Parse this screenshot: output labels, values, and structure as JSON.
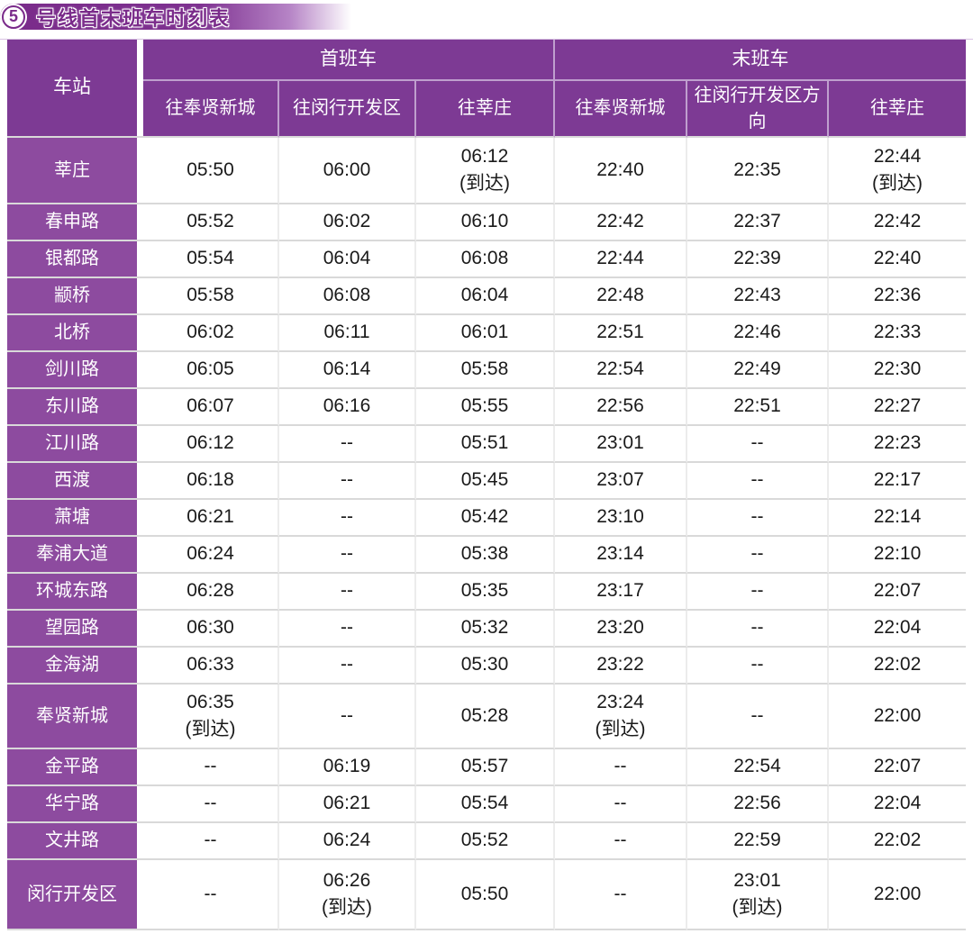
{
  "title": {
    "line_number": "5",
    "text": "号线首末班车时刻表"
  },
  "table": {
    "station_header": "车站",
    "groups": [
      {
        "label": "首班车",
        "columns": [
          "往奉贤新城",
          "往闵行开发区",
          "往莘庄"
        ]
      },
      {
        "label": "末班车",
        "columns": [
          "往奉贤新城",
          "往闵行开发区方向",
          "往莘庄"
        ]
      }
    ],
    "rows": [
      {
        "station": "莘庄",
        "times": [
          "05:50",
          "06:00",
          "06:12\n(到达)",
          "22:40",
          "22:35",
          "22:44\n(到达)"
        ]
      },
      {
        "station": "春申路",
        "times": [
          "05:52",
          "06:02",
          "06:10",
          "22:42",
          "22:37",
          "22:42"
        ]
      },
      {
        "station": "银都路",
        "times": [
          "05:54",
          "06:04",
          "06:08",
          "22:44",
          "22:39",
          "22:40"
        ]
      },
      {
        "station": "颛桥",
        "times": [
          "05:58",
          "06:08",
          "06:04",
          "22:48",
          "22:43",
          "22:36"
        ]
      },
      {
        "station": "北桥",
        "times": [
          "06:02",
          "06:11",
          "06:01",
          "22:51",
          "22:46",
          "22:33"
        ]
      },
      {
        "station": "剑川路",
        "times": [
          "06:05",
          "06:14",
          "05:58",
          "22:54",
          "22:49",
          "22:30"
        ]
      },
      {
        "station": "东川路",
        "times": [
          "06:07",
          "06:16",
          "05:55",
          "22:56",
          "22:51",
          "22:27"
        ]
      },
      {
        "station": "江川路",
        "times": [
          "06:12",
          "--",
          "05:51",
          "23:01",
          "--",
          "22:23"
        ]
      },
      {
        "station": "西渡",
        "times": [
          "06:18",
          "--",
          "05:45",
          "23:07",
          "--",
          "22:17"
        ]
      },
      {
        "station": "萧塘",
        "times": [
          "06:21",
          "--",
          "05:42",
          "23:10",
          "--",
          "22:14"
        ]
      },
      {
        "station": "奉浦大道",
        "times": [
          "06:24",
          "--",
          "05:38",
          "23:14",
          "--",
          "22:10"
        ]
      },
      {
        "station": "环城东路",
        "times": [
          "06:28",
          "--",
          "05:35",
          "23:17",
          "--",
          "22:07"
        ]
      },
      {
        "station": "望园路",
        "times": [
          "06:30",
          "--",
          "05:32",
          "23:20",
          "--",
          "22:04"
        ]
      },
      {
        "station": "金海湖",
        "times": [
          "06:33",
          "--",
          "05:30",
          "23:22",
          "--",
          "22:02"
        ]
      },
      {
        "station": "奉贤新城",
        "times": [
          "06:35\n(到达)",
          "--",
          "05:28",
          "23:24\n(到达)",
          "--",
          "22:00"
        ]
      },
      {
        "station": "金平路",
        "times": [
          "--",
          "06:19",
          "05:57",
          "--",
          "22:54",
          "22:07"
        ]
      },
      {
        "station": "华宁路",
        "times": [
          "--",
          "06:21",
          "05:54",
          "--",
          "22:56",
          "22:04"
        ]
      },
      {
        "station": "文井路",
        "times": [
          "--",
          "06:24",
          "05:52",
          "--",
          "22:59",
          "22:02"
        ]
      },
      {
        "station": "闵行开发区",
        "times": [
          "--",
          "06:26\n(到达)",
          "05:50",
          "--",
          "23:01\n(到达)",
          "22:00"
        ]
      }
    ]
  },
  "colors": {
    "banner_dark": "#7a2b8a",
    "header_purple": "#7d3a94",
    "station_purple": "#8d4b9f",
    "header_border": "#bf9fce",
    "grid_h": "#d9d9d9",
    "grid_v": "#ececec",
    "time_color": "#1a1a1a"
  }
}
